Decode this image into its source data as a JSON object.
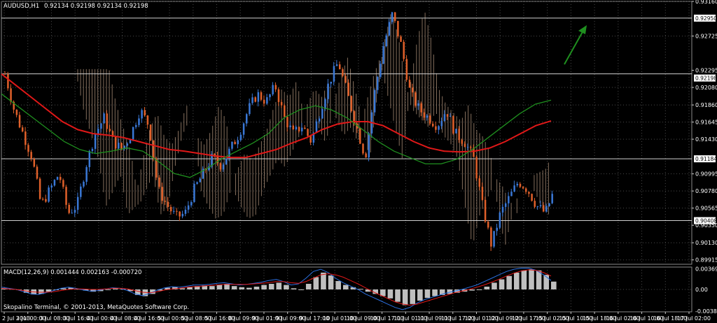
{
  "header": {
    "symbol": "AUDUSD,H1",
    "ohlc": "0.92134 0.92198 0.92134 0.92198",
    "macd_label": "MACD(12,26,9) 0.001444 0.002163 -0.000720",
    "copyright": "Skopalino Terminal, © 2001-2013, MetaQuotes Software Corp."
  },
  "colors": {
    "background": "#000000",
    "bull_candle": "#3a78d6",
    "bear_candle": "#e0602a",
    "ma_red": "#e01818",
    "ma_green": "#1f8f1f",
    "cloud": "#f0c8a8",
    "grid": "#4a4a4a"
  },
  "chart_data": [
    {
      "type": "line",
      "title": "AUDUSD,H1",
      "ylim": [
        0.8986,
        0.9316
      ],
      "yticks": [
        "0.93160",
        "0.92950",
        "0.92725",
        "0.92295",
        "0.92198",
        "0.92080",
        "0.91860",
        "0.91645",
        "0.91430",
        "0.91184",
        "0.90995",
        "0.90780",
        "0.90565",
        "0.90408",
        "0.90350",
        "0.90130",
        "0.89915"
      ],
      "x_labels": [
        "2 Jul 2013",
        "3 Jul 00:00",
        "3 Jul 08:00",
        "3 Jul 16:00",
        "4 Jul 00:00",
        "4 Jul 08:00",
        "4 Jul 16:00",
        "5 Jul 00:00",
        "5 Jul 08:00",
        "5 Jul 16:00",
        "8 Jul 09:00",
        "9 Jul 01:00",
        "9 Jul 09:00",
        "9 Jul 17:00",
        "10 Jul 01:00",
        "10 Jul 09:00",
        "10 Jul 17:00",
        "11 Jul 01:00",
        "11 Jul 09:00",
        "11 Jul 17:00",
        "12 Jul 01:00",
        "12 Jul 09:00",
        "12 Jul 17:00",
        "15 Jul 02:00",
        "15 Jul 10:00",
        "15 Jul 18:00",
        "16 Jul 02:00",
        "16 Jul 10:00",
        "16 Jul 18:00",
        "17 Jul 02:00"
      ],
      "horizontal_levels": [
        0.9295,
        0.9225,
        0.91184,
        0.90408
      ],
      "price_path": [
        0.9225,
        0.918,
        0.915,
        0.912,
        0.906,
        0.908,
        0.91,
        0.905,
        0.906,
        0.911,
        0.915,
        0.917,
        0.914,
        0.913,
        0.915,
        0.918,
        0.916,
        0.908,
        0.906,
        0.9045,
        0.905,
        0.908,
        0.91,
        0.912,
        0.911,
        0.913,
        0.915,
        0.918,
        0.92,
        0.919,
        0.921,
        0.917,
        0.915,
        0.916,
        0.914,
        0.918,
        0.9215,
        0.924,
        0.92,
        0.916,
        0.912,
        0.92,
        0.926,
        0.93,
        0.926,
        0.92,
        0.918,
        0.917,
        0.916,
        0.918,
        0.915,
        0.914,
        0.912,
        0.906,
        0.901,
        0.905,
        0.907,
        0.909,
        0.908,
        0.906,
        0.905,
        0.908,
        0.909,
        0.9095,
        0.91,
        0.912,
        0.915,
        0.918,
        0.92,
        0.922,
        0.9245,
        0.926,
        0.925,
        0.924,
        0.922
      ],
      "series": [
        {
          "values": [
            0.9225,
            0.921,
            0.9195,
            0.918,
            0.9165,
            0.9155,
            0.915,
            0.9148,
            0.9145,
            0.914,
            0.9135,
            0.913,
            0.9128,
            0.9125,
            0.9122,
            0.912,
            0.912,
            0.9125,
            0.913,
            0.9138,
            0.9145,
            0.9155,
            0.9162,
            0.9165,
            0.9165,
            0.916,
            0.915,
            0.914,
            0.9132,
            0.9128,
            0.9127,
            0.9128,
            0.9132,
            0.914,
            0.915,
            0.916,
            0.9166
          ]
        },
        {
          "values": [
            0.92,
            0.9185,
            0.917,
            0.9155,
            0.914,
            0.913,
            0.9125,
            0.9128,
            0.9132,
            0.9128,
            0.9115,
            0.91,
            0.9095,
            0.9105,
            0.9118,
            0.9128,
            0.9138,
            0.915,
            0.917,
            0.918,
            0.9185,
            0.918,
            0.917,
            0.9155,
            0.914,
            0.9128,
            0.912,
            0.9112,
            0.9112,
            0.9118,
            0.913,
            0.9145,
            0.916,
            0.9175,
            0.9187,
            0.9192
          ]
        }
      ]
    },
    {
      "type": "bar",
      "title": "MACD(12,26,9) 0.001444 0.002163 -0.000720",
      "ylim": [
        -0.00399,
        0.00399
      ],
      "yticks": [
        "0.003694",
        "0.00",
        "-0.003875"
      ],
      "histogram": [
        0.0002,
        0.0001,
        -0.0001,
        -0.0006,
        -0.0009,
        -0.0008,
        -0.0004,
        0.0,
        0.0002,
        0.0003,
        0.0001,
        -0.0002,
        -0.0004,
        -0.0003,
        0.0,
        0.0002,
        0.0001,
        -0.0003,
        -0.001,
        -0.0012,
        -0.0008,
        -0.0002,
        0.0003,
        0.0004,
        0.0002,
        0.0004,
        0.0006,
        0.0007,
        0.0006,
        0.0008,
        0.001,
        0.0006,
        0.0004,
        0.0003,
        0.0005,
        0.0008,
        0.001,
        0.0012,
        0.0008,
        0.0002,
        0.0,
        0.001,
        0.0022,
        0.003,
        0.0025,
        0.0015,
        0.0008,
        0.0004,
        0.0001,
        -0.0004,
        -0.0008,
        -0.0012,
        -0.0016,
        -0.0022,
        -0.0028,
        -0.0026,
        -0.002,
        -0.0015,
        -0.0012,
        -0.001,
        -0.0008,
        -0.0006,
        -0.0004,
        -0.0002,
        0.0,
        0.0005,
        0.0012,
        0.0018,
        0.0024,
        0.003,
        0.0034,
        0.0036,
        0.0034,
        0.0026,
        0.0014
      ],
      "series": [
        {
          "values": [
            0.0004,
            0.0002,
            0.0,
            -0.0004,
            -0.0008,
            -0.0009,
            -0.0006,
            -0.0002,
            0.0002,
            0.0004,
            0.0002,
            -0.0001,
            -0.0003,
            -0.0002,
            0.0001,
            0.0003,
            0.0002,
            -0.0002,
            -0.0008,
            -0.0011,
            -0.0007,
            -0.0001,
            0.0003,
            0.0005,
            0.0004,
            0.0006,
            0.0008,
            0.0008,
            0.0009,
            0.0011,
            0.0012,
            0.001,
            0.0008,
            0.0009,
            0.0011,
            0.0013,
            0.0016,
            0.0018,
            0.0014,
            0.0008,
            0.001,
            0.002,
            0.0032,
            0.0036,
            0.003,
            0.002,
            0.0012,
            0.0006,
            0.0,
            -0.0008,
            -0.0014,
            -0.002,
            -0.0026,
            -0.0032,
            -0.0036,
            -0.0032,
            -0.0024,
            -0.0018,
            -0.0014,
            -0.001,
            -0.0006,
            -0.0003,
            0.0,
            0.0004,
            0.0008,
            0.0014,
            0.002,
            0.0026,
            0.0032,
            0.0036,
            0.0038,
            0.0038,
            0.0034,
            0.0026,
            0.0016
          ]
        },
        {
          "values": [
            0.0002,
            0.0001,
            0.0,
            -0.0002,
            -0.0004,
            -0.0005,
            -0.0005,
            -0.0004,
            -0.0002,
            0.0,
            0.0001,
            0.0001,
            0.0,
            0.0,
            0.0001,
            0.0002,
            0.0002,
            0.0001,
            -0.0002,
            -0.0005,
            -0.0006,
            -0.0004,
            -0.0001,
            0.0001,
            0.0002,
            0.0004,
            0.0005,
            0.0006,
            0.0007,
            0.0008,
            0.0009,
            0.0009,
            0.0009,
            0.0009,
            0.001,
            0.0011,
            0.0012,
            0.0014,
            0.0014,
            0.0012,
            0.0011,
            0.0014,
            0.002,
            0.0026,
            0.0028,
            0.0026,
            0.0022,
            0.0016,
            0.001,
            0.0003,
            -0.0004,
            -0.001,
            -0.0016,
            -0.0022,
            -0.0026,
            -0.0028,
            -0.0026,
            -0.0022,
            -0.0018,
            -0.0014,
            -0.001,
            -0.0006,
            -0.0003,
            0.0,
            0.0004,
            0.0008,
            0.0013,
            0.0018,
            0.0024,
            0.0029,
            0.0033,
            0.0035,
            0.0034,
            0.003,
            0.0024
          ]
        }
      ]
    }
  ]
}
